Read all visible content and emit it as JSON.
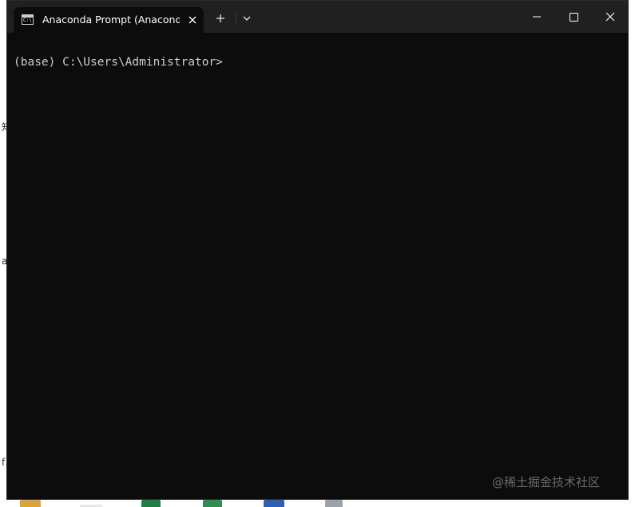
{
  "window": {
    "tab_title": "Anaconda Prompt (Anaconda",
    "tab_icon": "terminal-icon",
    "buttons": {
      "close_tab": "close-icon",
      "new_tab": "plus-icon",
      "dropdown": "chevron-down-icon",
      "minimize": "minimize-icon",
      "maximize": "maximize-icon",
      "close": "close-icon"
    }
  },
  "terminal": {
    "prompt": "(base) C:\\Users\\Administrator>"
  },
  "background": {
    "peek_chars": [
      "知",
      "a",
      "f"
    ]
  },
  "watermark": "@稀土掘金技术社区",
  "colors": {
    "terminal_bg": "#0c0c0c",
    "titlebar_bg": "#202020",
    "text": "#cccccc"
  }
}
